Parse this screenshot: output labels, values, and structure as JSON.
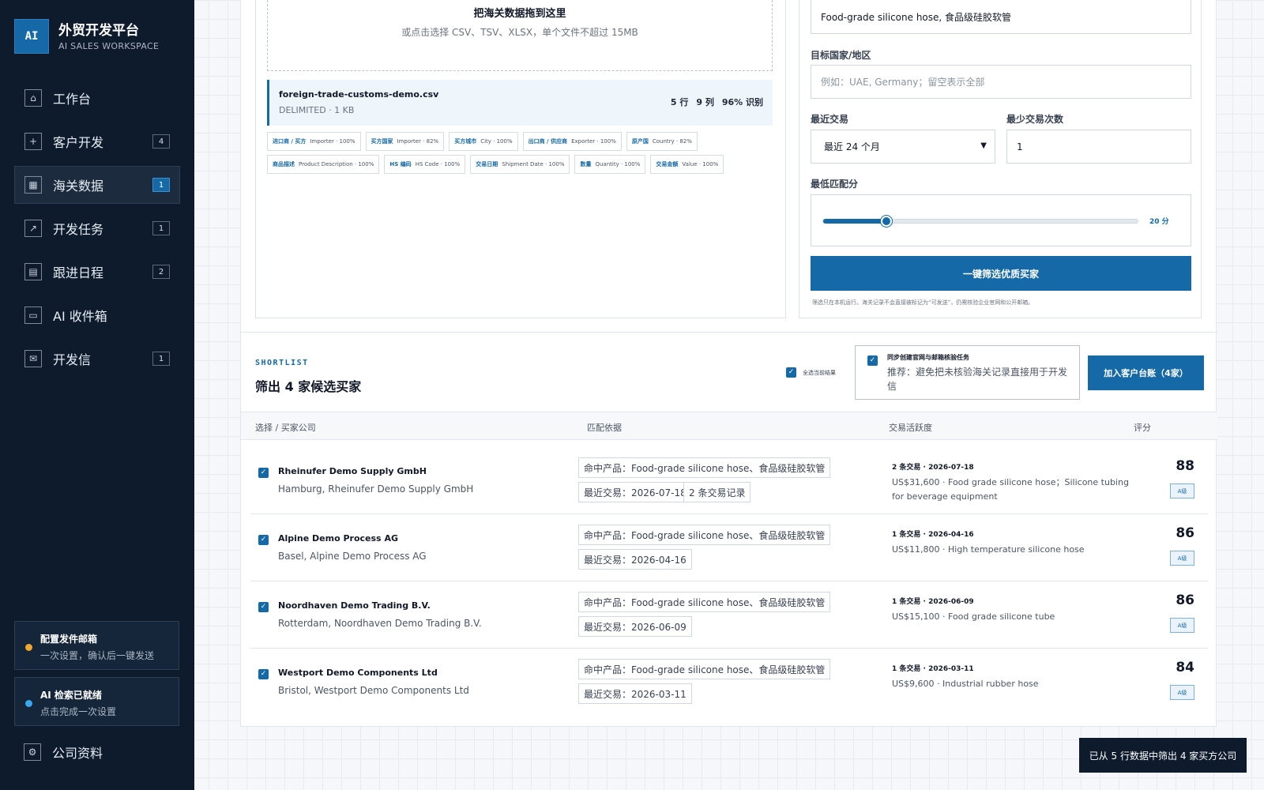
{
  "brand": {
    "logo": "AI",
    "title": "外贸开发平台",
    "subtitle": "AI SALES WORKSPACE"
  },
  "sidebar": {
    "items": [
      {
        "label": "工作台",
        "icon": "home-icon",
        "badge": ""
      },
      {
        "label": "客户开发",
        "icon": "add-user-icon",
        "badge": "4"
      },
      {
        "label": "海关数据",
        "icon": "table-icon",
        "badge": "1",
        "active": true
      },
      {
        "label": "开发任务",
        "icon": "external-link-icon",
        "badge": "1"
      },
      {
        "label": "跟进日程",
        "icon": "calendar-icon",
        "badge": "2"
      },
      {
        "label": "AI 收件箱",
        "icon": "inbox-icon",
        "badge": ""
      },
      {
        "label": "开发信",
        "icon": "mail-icon",
        "badge": "1"
      }
    ],
    "status_cards": [
      {
        "title": "配置发件邮箱",
        "sub": "一次设置，确认后一键发送",
        "dot_color": "#f0a830"
      },
      {
        "title": "AI 检索已就绪",
        "sub": "点击完成一次设置",
        "dot_color": "#3ba7f0"
      }
    ],
    "settings_label": "公司资料"
  },
  "upload": {
    "title": "把海关数据拖到这里",
    "sub": "或点击选择 CSV、TSV、XLSX，单个文件不超过 15MB",
    "file_name": "foreign-trade-customs-demo.csv",
    "file_meta": "DELIMITED · 1 KB",
    "stats": [
      "5 行",
      "9 列",
      "96% 识别"
    ],
    "tags": [
      {
        "key": "进口商 / 买方",
        "val": "Importer · 100%"
      },
      {
        "key": "买方国家",
        "val": "Importer · 82%"
      },
      {
        "key": "买方城市",
        "val": "City · 100%"
      },
      {
        "key": "出口商 / 供应商",
        "val": "Exporter · 100%"
      },
      {
        "key": "原产国",
        "val": "Country · 82%"
      },
      {
        "key": "商品描述",
        "val": "Product Description · 100%"
      },
      {
        "key": "HS 编码",
        "val": "HS Code · 100%"
      },
      {
        "key": "交易日期",
        "val": "Shipment Date · 100%"
      },
      {
        "key": "数量",
        "val": "Quantity · 100%"
      },
      {
        "key": "交易金额",
        "val": "Value · 100%"
      }
    ]
  },
  "filters": {
    "product_value": "Food-grade silicone hose, 食品级硅胶软管",
    "country_label": "目标国家/地区",
    "country_placeholder": "例如：UAE, Germany；留空表示全部",
    "recent_label": "最近交易",
    "recent_value": "最近 24 个月",
    "min_label": "最少交易次数",
    "min_value": "1",
    "score_label": "最低匹配分",
    "score_value": 20,
    "score_max": 100,
    "score_text": "20 分",
    "button": "一键筛选优质买家",
    "note": "筛选只在本机运行。海关记录不会直接被标记为“可发送”，仍需核验企业官网和公开邮箱。"
  },
  "shortlist": {
    "kicker": "SHORTLIST",
    "title": "筛出 4 家候选买家",
    "select_all": "全选当前结果",
    "sync_title": "同步创建官网与邮箱核验任务",
    "sync_sub": "推荐：避免把未核验海关记录直接用于开发信",
    "add_button": "加入客户台账（4家）",
    "headers": [
      "选择 / 买家公司",
      "匹配依据",
      "交易活跃度",
      "评分"
    ],
    "rows": [
      {
        "name": "Rheinufer Demo Supply GmbH",
        "loc": "Hamburg, Rheinufer Demo Supply GmbH",
        "chips": [
          "命中产品：Food-grade silicone hose、食品级硅胶软管",
          "最近交易：2026-07-18",
          "2 条交易记录"
        ],
        "act_title": "2 条交易 · 2026-07-18",
        "act_desc": "US$31,600 · Food grade silicone hose；Silicone tubing for beverage equipment",
        "score": "88",
        "grade": "A级"
      },
      {
        "name": "Alpine Demo Process AG",
        "loc": "Basel, Alpine Demo Process AG",
        "chips": [
          "命中产品：Food-grade silicone hose、食品级硅胶软管",
          "最近交易：2026-04-16"
        ],
        "act_title": "1 条交易 · 2026-04-16",
        "act_desc": "US$11,800 · High temperature silicone hose",
        "score": "86",
        "grade": "A级"
      },
      {
        "name": "Noordhaven Demo Trading B.V.",
        "loc": "Rotterdam, Noordhaven Demo Trading B.V.",
        "chips": [
          "命中产品：Food-grade silicone hose、食品级硅胶软管",
          "最近交易：2026-06-09"
        ],
        "act_title": "1 条交易 · 2026-06-09",
        "act_desc": "US$15,100 · Food grade silicone tube",
        "score": "86",
        "grade": "A级"
      },
      {
        "name": "Westport Demo Components Ltd",
        "loc": "Bristol, Westport Demo Components Ltd",
        "chips": [
          "命中产品：Food-grade silicone hose、食品级硅胶软管",
          "最近交易：2026-03-11"
        ],
        "act_title": "1 条交易 · 2026-03-11",
        "act_desc": "US$9,600 · Industrial rubber hose",
        "score": "84",
        "grade": "A级"
      }
    ]
  },
  "toast": "已从 5 行数据中筛出 4 家买方公司",
  "colors": {
    "accent": "#1569a6",
    "sidebar_bg": "#0e1b2c"
  }
}
